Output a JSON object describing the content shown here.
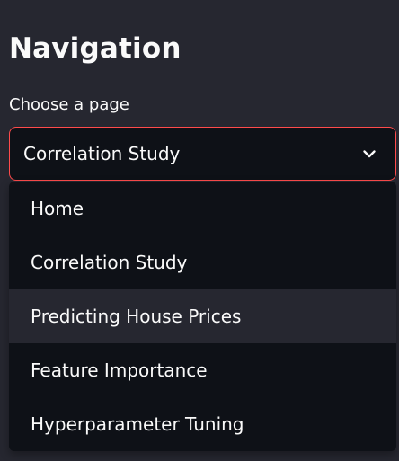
{
  "sidebar": {
    "title": "Navigation",
    "select_label": "Choose a page",
    "selected_value": "Correlation Study",
    "dropdown_icon": "chevron-down-icon",
    "highlighted_index": 2,
    "options": [
      {
        "label": "Home"
      },
      {
        "label": "Correlation Study"
      },
      {
        "label": "Predicting House Prices"
      },
      {
        "label": "Feature Importance"
      },
      {
        "label": "Hyperparameter Tuning"
      }
    ]
  },
  "colors": {
    "background": "#262730",
    "input_background": "#0e1117",
    "focus_border": "#ff4b4b",
    "highlight": "#262730",
    "text": "#fafafa"
  }
}
